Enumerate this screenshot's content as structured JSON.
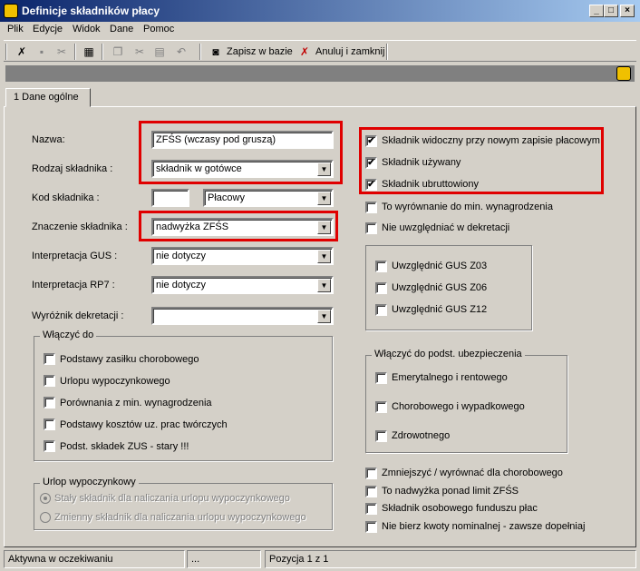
{
  "window": {
    "title": "Definicje składników płacy",
    "min": "_",
    "max": "□",
    "close": "×"
  },
  "menu": [
    "Plik",
    "Edycje",
    "Widok",
    "Dane",
    "Pomoc"
  ],
  "toolbar": {
    "save": "Zapisz w bazie",
    "cancel": "Anuluj i zamknij"
  },
  "tab": "1 Dane ogólne",
  "fields": {
    "nazwa": {
      "label": "Nazwa:",
      "value": "ZFŚS (wczasy pod gruszą)"
    },
    "rodzaj": {
      "label": "Rodzaj składnika :",
      "value": "składnik w gotówce"
    },
    "kod": {
      "label": "Kod składnika :",
      "value": "",
      "type": "Płacowy"
    },
    "znaczenie": {
      "label": "Znaczenie składnika :",
      "value": "nadwyżka ZFŚS"
    },
    "gus": {
      "label": "Interpretacja GUS :",
      "value": "nie dotyczy"
    },
    "rp7": {
      "label": "Interpretacja RP7 :",
      "value": "nie dotyczy"
    },
    "wyroznik": {
      "label": "Wyróżnik dekretacji :",
      "value": ""
    }
  },
  "wlaczyc": {
    "title": "Włączyć do",
    "items": [
      "Podstawy zasiłku chorobowego",
      "Urlopu wypoczynkowego",
      "Porównania z min. wynagrodzenia",
      "Podstawy kosztów uz. prac twórczych",
      "Podst. składek ZUS - stary !!!"
    ]
  },
  "urlop": {
    "title": "Urlop wypoczynkowy",
    "opt1": "Stały składnik dla naliczania urlopu wypoczynkowego",
    "opt2": "Zmienny składnik dla naliczania urlopu wypoczynkowego"
  },
  "right_checks": [
    {
      "label": "Składnik widoczny przy nowym zapisie płacowym",
      "checked": true
    },
    {
      "label": "Składnik używany",
      "checked": true
    },
    {
      "label": "Składnik ubruttowiony",
      "checked": true
    },
    {
      "label": "To wyrównanie do min. wynagrodzenia",
      "checked": false
    },
    {
      "label": "Nie uwzględniać w dekretacji",
      "checked": false
    }
  ],
  "gus_checks": [
    "Uwzględnić GUS Z03",
    "Uwzględnić GUS Z06",
    "Uwzględnić GUS Z12"
  ],
  "ubezp": {
    "title": "Włączyć do podst. ubezpieczenia",
    "items": [
      "Emerytalnego i rentowego",
      "Chorobowego i wypadkowego",
      "Zdrowotnego"
    ]
  },
  "bottom_checks": [
    "Zmniejszyć / wyrównać dla chorobowego",
    "To nadwyżka ponad limit ZFŚS",
    "Składnik osobowego funduszu płac",
    "Nie bierz kwoty nominalnej - zawsze dopełniaj"
  ],
  "status": {
    "state": "Aktywna w oczekiwaniu",
    "mid": "...",
    "pos": "Pozycja 1 z 1"
  },
  "check_mark": "✔",
  "dd_arrow": "▼",
  "colors": {
    "highlight": "#e00000",
    "titlebar": "#0a246a"
  }
}
